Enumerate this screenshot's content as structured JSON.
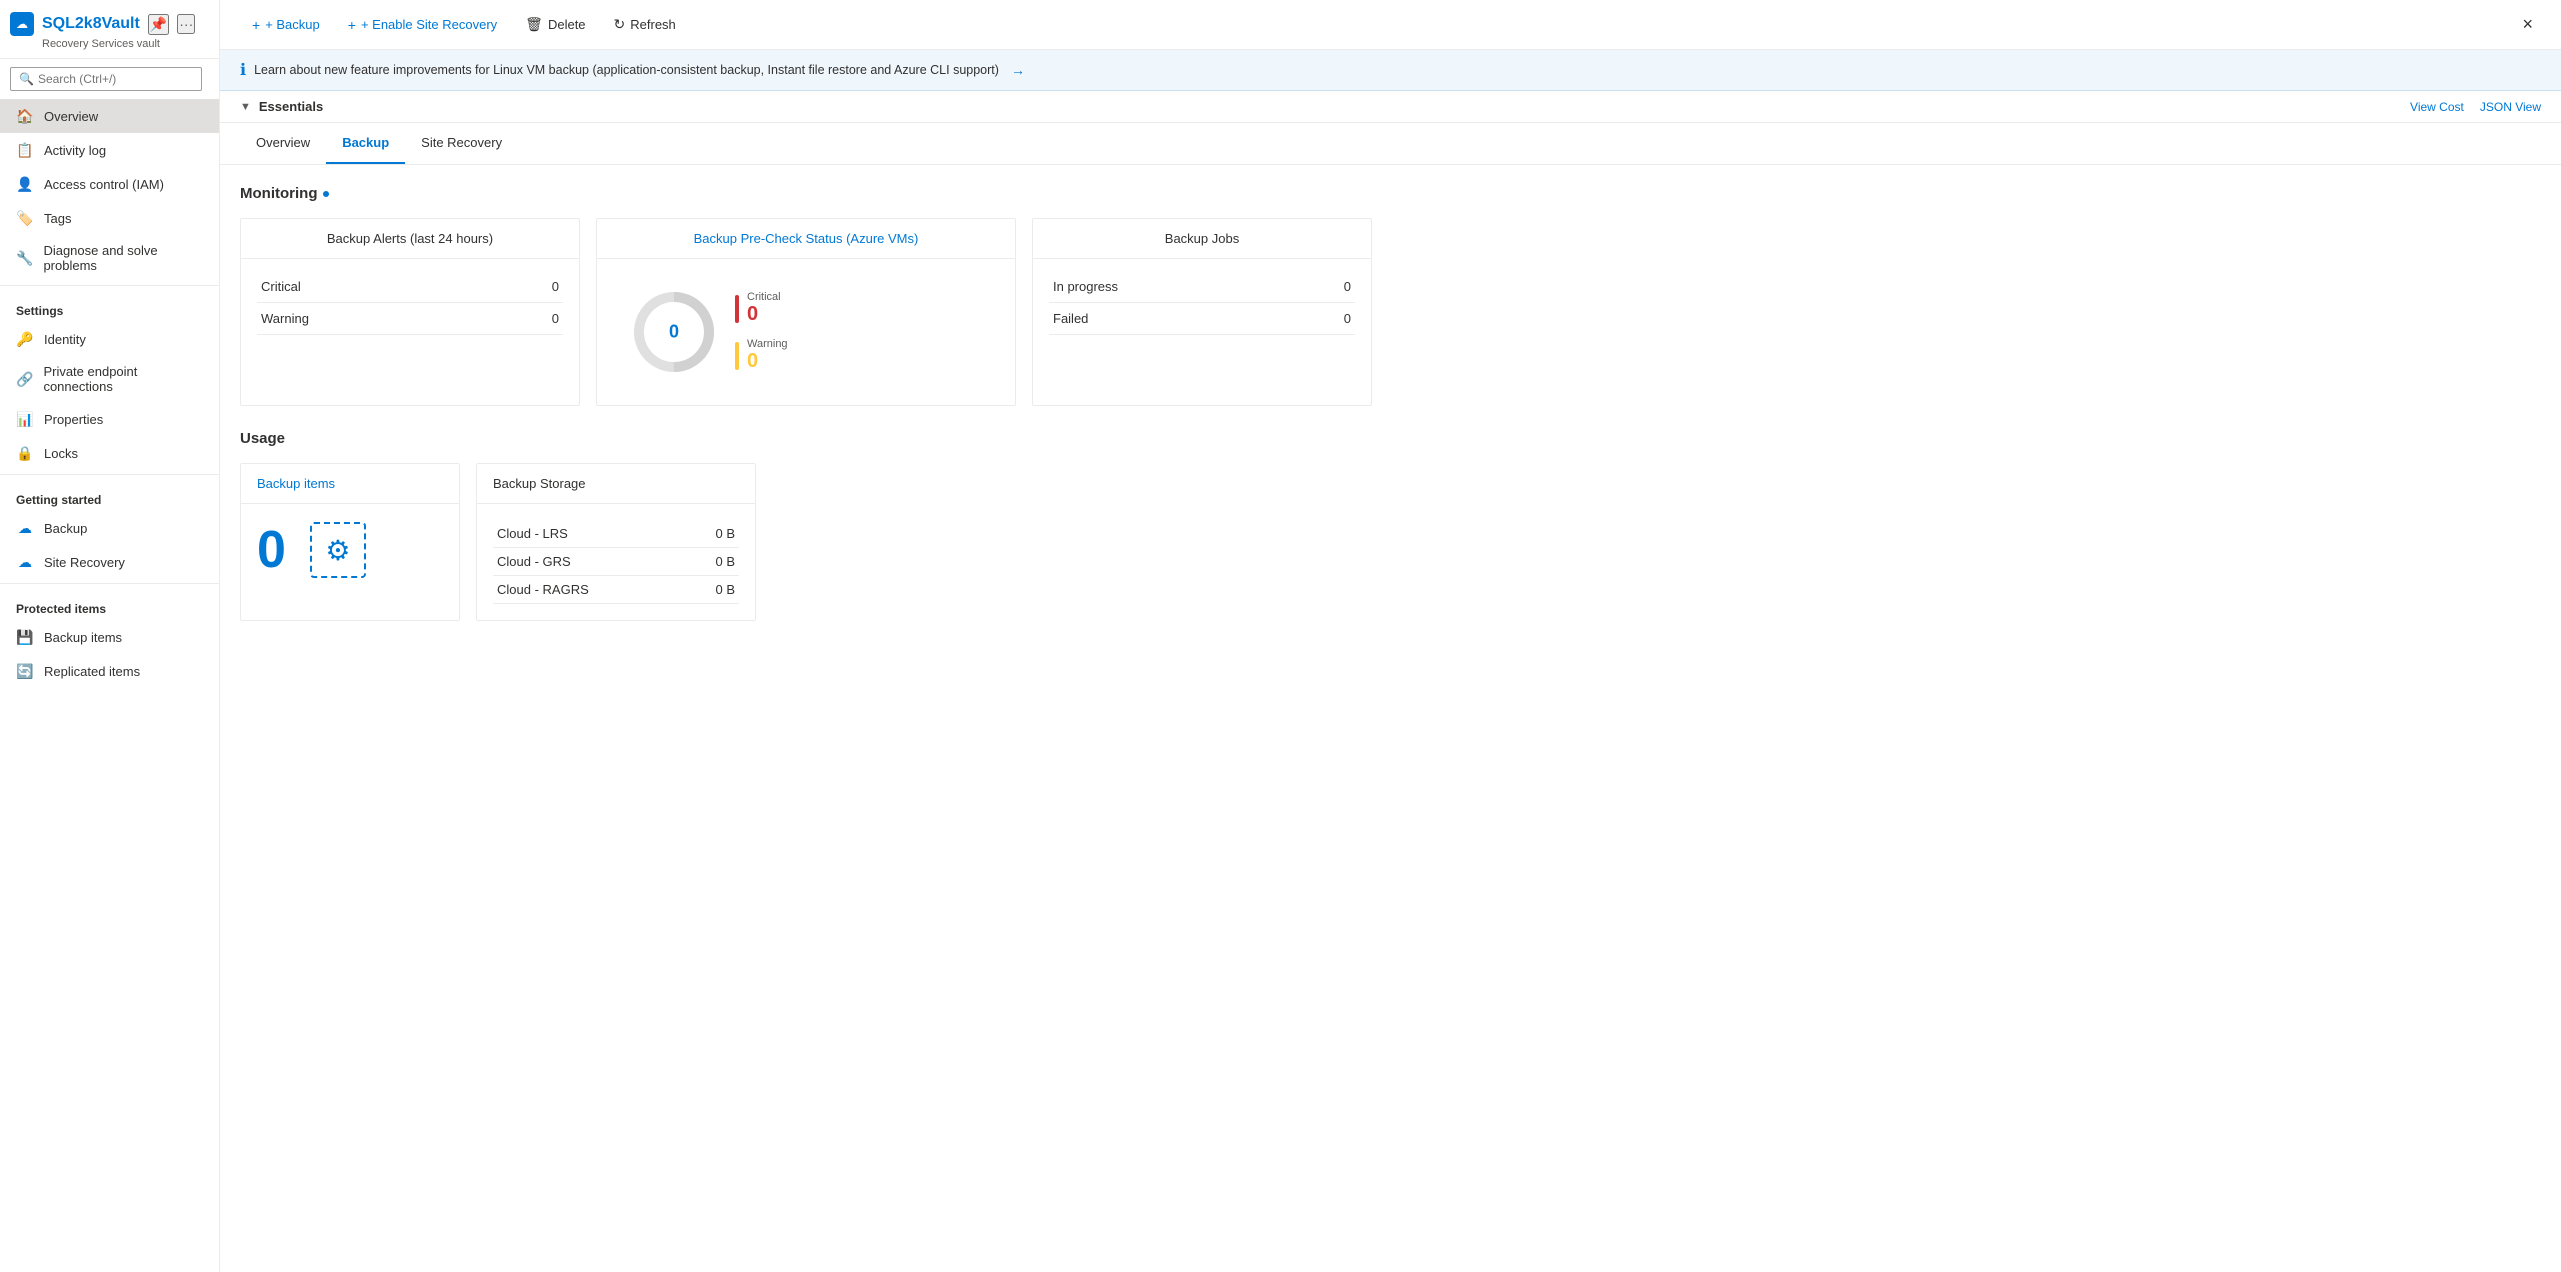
{
  "app": {
    "vault_name": "SQL2k8Vault",
    "vault_type": "Recovery Services vault",
    "close_label": "×"
  },
  "sidebar": {
    "search_placeholder": "Search (Ctrl+/)",
    "nav_items": [
      {
        "id": "overview",
        "label": "Overview",
        "icon": "🏠",
        "active": true
      },
      {
        "id": "activity-log",
        "label": "Activity log",
        "icon": "📋"
      },
      {
        "id": "access-control",
        "label": "Access control (IAM)",
        "icon": "👤"
      },
      {
        "id": "tags",
        "label": "Tags",
        "icon": "🏷️"
      },
      {
        "id": "diagnose",
        "label": "Diagnose and solve problems",
        "icon": "🔧"
      }
    ],
    "settings_section": "Settings",
    "settings_items": [
      {
        "id": "identity",
        "label": "Identity",
        "icon": "🔑"
      },
      {
        "id": "private-endpoint",
        "label": "Private endpoint connections",
        "icon": "🔗"
      },
      {
        "id": "properties",
        "label": "Properties",
        "icon": "📊"
      },
      {
        "id": "locks",
        "label": "Locks",
        "icon": "🔒"
      }
    ],
    "getting_started_section": "Getting started",
    "getting_started_items": [
      {
        "id": "backup",
        "label": "Backup",
        "icon": "☁️"
      },
      {
        "id": "site-recovery",
        "label": "Site Recovery",
        "icon": "☁️"
      }
    ],
    "protected_items_section": "Protected items",
    "protected_items": [
      {
        "id": "backup-items",
        "label": "Backup items",
        "icon": "💾"
      },
      {
        "id": "replicated-items",
        "label": "Replicated items",
        "icon": "🔄"
      }
    ]
  },
  "toolbar": {
    "backup_label": "+ Backup",
    "enable_site_recovery_label": "+ Enable Site Recovery",
    "delete_label": "Delete",
    "refresh_label": "Refresh"
  },
  "info_banner": {
    "text": "Learn about new feature improvements for Linux VM backup (application-consistent backup, Instant file restore and Azure CLI support)",
    "arrow": "→"
  },
  "essentials": {
    "title": "Essentials",
    "view_cost_label": "View Cost",
    "json_view_label": "JSON View"
  },
  "tabs": [
    {
      "id": "overview-tab",
      "label": "Overview",
      "active": false
    },
    {
      "id": "backup-tab",
      "label": "Backup",
      "active": true
    },
    {
      "id": "site-recovery-tab",
      "label": "Site Recovery",
      "active": false
    }
  ],
  "monitoring": {
    "section_title": "Monitoring",
    "backup_alerts": {
      "title": "Backup Alerts (last 24 hours)",
      "critical_label": "Critical",
      "critical_value": "0",
      "warning_label": "Warning",
      "warning_value": "0"
    },
    "pre_check": {
      "title": "Backup Pre-Check Status (Azure VMs)",
      "center_value": "0",
      "critical_label": "Critical",
      "critical_value": "0",
      "warning_label": "Warning",
      "warning_value": "0"
    },
    "backup_jobs": {
      "title": "Backup Jobs",
      "in_progress_label": "In progress",
      "in_progress_value": "0",
      "failed_label": "Failed",
      "failed_value": "0"
    }
  },
  "usage": {
    "section_title": "Usage",
    "backup_items": {
      "title": "Backup items",
      "count": "0"
    },
    "backup_storage": {
      "title": "Backup Storage",
      "rows": [
        {
          "label": "Cloud - LRS",
          "value": "0 B"
        },
        {
          "label": "Cloud - GRS",
          "value": "0 B"
        },
        {
          "label": "Cloud - RAGRS",
          "value": "0 B"
        }
      ]
    }
  }
}
